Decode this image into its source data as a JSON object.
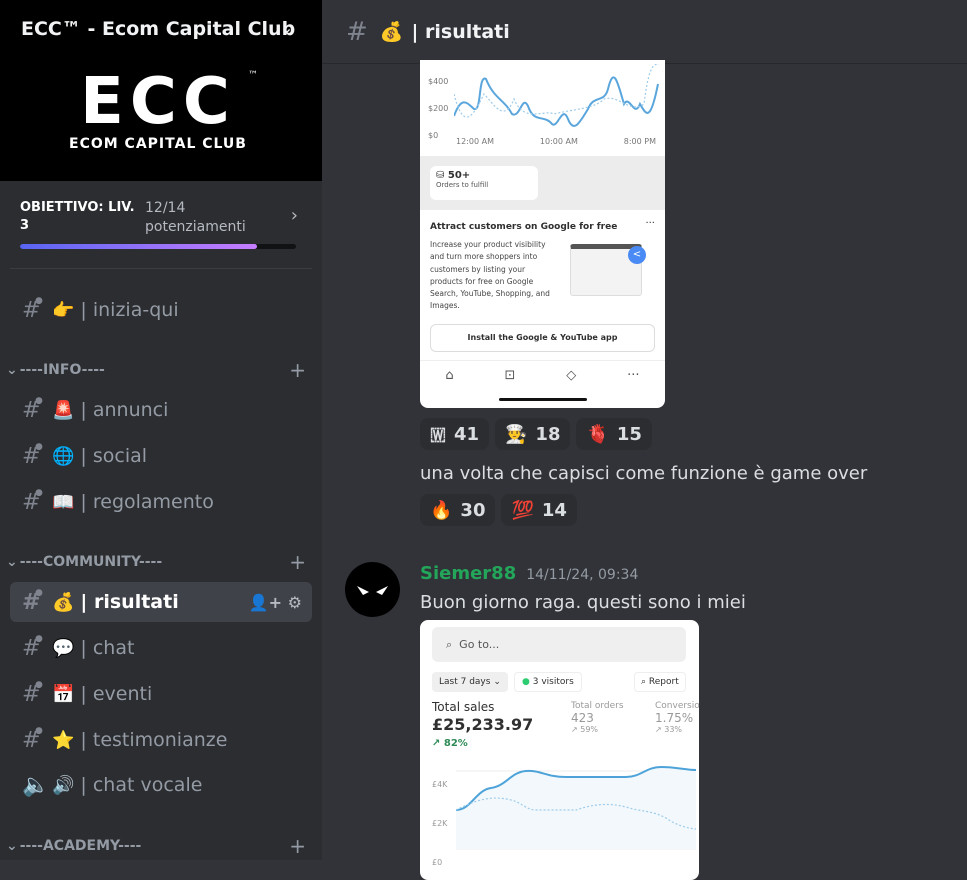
{
  "server": {
    "name": "ECC™ - Ecom Capital Club",
    "logo_text": "ECC",
    "logo_sub": "ECOM CAPITAL CLUB"
  },
  "goal": {
    "title": "OBIETTIVO: LIV. 3",
    "count": "12/14",
    "sub": "potenziamenti",
    "progress": 0.857
  },
  "channels": [
    {
      "emoji": "👉",
      "label": "| inizia-qui"
    },
    {
      "category": "----INFO----"
    },
    {
      "emoji": "🚨",
      "label": "| annunci"
    },
    {
      "emoji": "🌐",
      "label": "| social"
    },
    {
      "emoji": "📖",
      "label": "| regolamento"
    },
    {
      "category": "----COMMUNITY----"
    },
    {
      "emoji": "💰",
      "label": "| risultati",
      "selected": true
    },
    {
      "emoji": "💬",
      "label": "| chat"
    },
    {
      "emoji": "📅",
      "label": "| eventi"
    },
    {
      "emoji": "⭐",
      "label": "| testimonianze"
    },
    {
      "emoji": "🔊",
      "label": "| chat vocale",
      "voice": true
    },
    {
      "category": "----ACADEMY----"
    }
  ],
  "header": {
    "emoji": "💰",
    "title": "| risultati"
  },
  "shot1": {
    "y_ticks": [
      "$400",
      "$200",
      "$0"
    ],
    "x_ticks": [
      "12:00 AM",
      "10:00 AM",
      "8:00 PM"
    ],
    "orders": "50+",
    "orders_label": "Orders to fulfill",
    "card_title": "Attract customers on Google for free",
    "card_body": "Increase your product visibility and turn more shoppers into customers by listing your products for free on Google Search, YouTube, Shopping, and Images.",
    "card_button": "Install the Google & YouTube app"
  },
  "reactions1": [
    {
      "emoji": "🇼",
      "count": "41"
    },
    {
      "emoji": "👨‍🍳",
      "count": "18"
    },
    {
      "emoji": "🫀",
      "count": "15"
    }
  ],
  "message1": "una volta che capisci come funzione è game over",
  "reactions2": [
    {
      "emoji": "🔥",
      "count": "30"
    },
    {
      "emoji": "💯",
      "count": "14"
    }
  ],
  "message2": {
    "author": "Siemer88",
    "author_color": "#23a55a",
    "timestamp": "14/11/24, 09:34",
    "text": "Buon giorno raga. questi sono i miei"
  },
  "shot2": {
    "search": "Go to...",
    "range": "Last 7 days",
    "visitors": "3 visitors",
    "report": "Report",
    "sales_label": "Total sales",
    "sales": "£25,233.97",
    "sales_change": "82%",
    "orders_label": "Total orders",
    "orders": "423",
    "orders_change": "59%",
    "conv_label": "Conversio",
    "conv": "1.75%",
    "conv_change": "33%",
    "y_ticks": [
      "£4K",
      "£2K",
      "£0"
    ]
  }
}
